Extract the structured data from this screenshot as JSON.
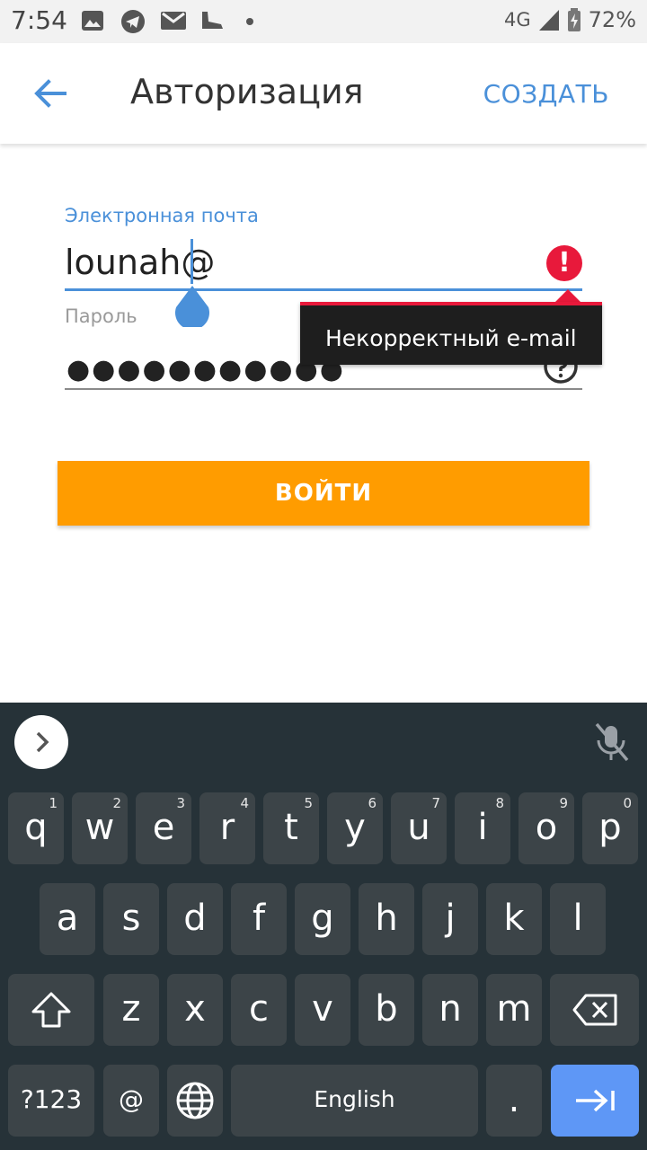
{
  "status_bar": {
    "time": "7:54",
    "network": "4G",
    "battery": "72%",
    "left_icons": [
      "image-icon",
      "telegram-icon",
      "gmail-icon",
      "shoe-icon",
      "dot-icon"
    ]
  },
  "toolbar": {
    "title": "Авторизация",
    "action": "СОЗДАТЬ"
  },
  "form": {
    "email_label": "Электронная почта",
    "email_value": "lounah@",
    "password_label": "Пароль",
    "password_value": "●●●●●●●●●●●",
    "error_tooltip": "Некорректный e-mail",
    "login_button": "ВОЙТИ"
  },
  "keyboard": {
    "row1": [
      {
        "k": "q",
        "h": "1"
      },
      {
        "k": "w",
        "h": "2"
      },
      {
        "k": "e",
        "h": "3"
      },
      {
        "k": "r",
        "h": "4"
      },
      {
        "k": "t",
        "h": "5"
      },
      {
        "k": "y",
        "h": "6"
      },
      {
        "k": "u",
        "h": "7"
      },
      {
        "k": "i",
        "h": "8"
      },
      {
        "k": "o",
        "h": "9"
      },
      {
        "k": "p",
        "h": "0"
      }
    ],
    "row2": [
      "a",
      "s",
      "d",
      "f",
      "g",
      "h",
      "j",
      "k",
      "l"
    ],
    "row3": [
      "z",
      "x",
      "c",
      "v",
      "b",
      "n",
      "m"
    ],
    "symbols": "?123",
    "at": "@",
    "space": "English",
    "period": ".",
    "colors": {
      "accent": "#4a90d9",
      "error": "#e8193b",
      "button": "#ff9c00",
      "keyboard_bg": "#263238",
      "key_bg": "#3c4448",
      "enter": "#5e97f6"
    }
  }
}
